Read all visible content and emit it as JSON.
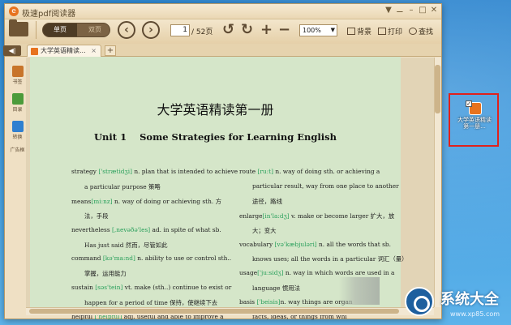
{
  "app": {
    "title": "极速pdf阅读器",
    "window_controls": [
      "▼",
      "⚊",
      "–",
      "□",
      "✕"
    ]
  },
  "toolbar": {
    "view_single": "单页",
    "view_double": "双页",
    "page_current": "1",
    "page_total": "/ 52页",
    "zoom": "100%",
    "background": "背景",
    "print": "打印",
    "find": "查找"
  },
  "tabs": [
    {
      "label": "大学英语精读..."
    }
  ],
  "sidebar": {
    "items": [
      {
        "label": "书签"
      },
      {
        "label": "目录"
      },
      {
        "label": "转换"
      },
      {
        "label": "广告框"
      }
    ]
  },
  "document": {
    "title": "大学英语精读第一册",
    "subtitle": "Unit 1    Some Strategies for Learning English",
    "left_column": [
      {
        "pre": "strategy ",
        "ph": "['strætidʒi]",
        "post": " n. plan that is intended to achieve"
      },
      {
        "pre": "a particular purpose 策略",
        "ph": "",
        "post": ""
      },
      {
        "pre": "means",
        "ph": "[mi:nz]",
        "post": " n. way of doing or achieving sth. 方"
      },
      {
        "pre": "法，手段",
        "ph": "",
        "post": ""
      },
      {
        "pre": "nevertheless ",
        "ph": "[,nevəðə'les]",
        "post": " ad.   in spite of what sb."
      },
      {
        "pre": "Has just said 然而，尽管如此",
        "ph": "",
        "post": ""
      },
      {
        "pre": "command ",
        "ph": "[kə'ma:nd]",
        "post": " n. ability to use or control sth.."
      },
      {
        "pre": "掌握，运用能力",
        "ph": "",
        "post": ""
      },
      {
        "pre": "sustain ",
        "ph": "[səs'tein]",
        "post": " vt. make (sth..) continue to exist or"
      },
      {
        "pre": "happen for a period of time 保持，使继续下去",
        "ph": "",
        "post": ""
      },
      {
        "pre": "helpful ",
        "ph": "['helpful]",
        "post": " adj. useful and able to improve a"
      }
    ],
    "right_column": [
      {
        "pre": "route ",
        "ph": "[ru:t]",
        "post": " n. way of doing sth. or achieving a"
      },
      {
        "pre": "particular result, way from one place to another",
        "ph": "",
        "post": ""
      },
      {
        "pre": "途径，路线",
        "ph": "",
        "post": ""
      },
      {
        "pre": "enlarge",
        "ph": "[in'la:dʒ]",
        "post": " v. make or become larger 扩大，放"
      },
      {
        "pre": "大；变大",
        "ph": "",
        "post": ""
      },
      {
        "pre": "vocabulary ",
        "ph": "[və'kæbjuləri]",
        "post": " n. all the words that sb."
      },
      {
        "pre": "knows uses; all the words in a particular 词汇（量）",
        "ph": "",
        "post": ""
      },
      {
        "pre": "usage",
        "ph": "['ju:sidʒ]",
        "post": " n. way in which words are used in a"
      },
      {
        "pre": "language 惯用法",
        "ph": "",
        "post": ""
      },
      {
        "pre": "basis ",
        "ph": "['beisis]",
        "post": "n. way things are organ"
      },
      {
        "pre": "facts, ideas, or things from whi",
        "ph": "",
        "post": ""
      }
    ]
  },
  "desktop_icon": {
    "label": "大学英语精读第一册..."
  },
  "watermark": {
    "brand": "系统大全",
    "url": "www.xp85.com"
  },
  "colors": {
    "accent": "#e7731f",
    "highlight_box": "#e0211c",
    "phonetic": "#2aa05c",
    "page_bg": "#d5e6c9"
  }
}
